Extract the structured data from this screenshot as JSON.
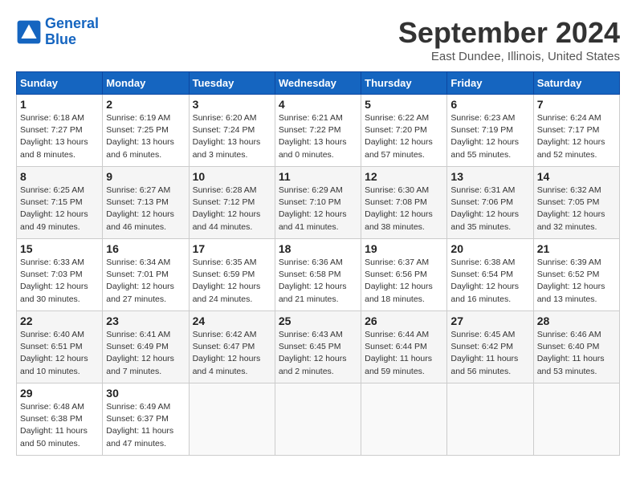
{
  "logo": {
    "line1": "General",
    "line2": "Blue"
  },
  "title": "September 2024",
  "subtitle": "East Dundee, Illinois, United States",
  "weekdays": [
    "Sunday",
    "Monday",
    "Tuesday",
    "Wednesday",
    "Thursday",
    "Friday",
    "Saturday"
  ],
  "weeks": [
    [
      {
        "day": "1",
        "sunrise": "Sunrise: 6:18 AM",
        "sunset": "Sunset: 7:27 PM",
        "daylight": "Daylight: 13 hours and 8 minutes."
      },
      {
        "day": "2",
        "sunrise": "Sunrise: 6:19 AM",
        "sunset": "Sunset: 7:25 PM",
        "daylight": "Daylight: 13 hours and 6 minutes."
      },
      {
        "day": "3",
        "sunrise": "Sunrise: 6:20 AM",
        "sunset": "Sunset: 7:24 PM",
        "daylight": "Daylight: 13 hours and 3 minutes."
      },
      {
        "day": "4",
        "sunrise": "Sunrise: 6:21 AM",
        "sunset": "Sunset: 7:22 PM",
        "daylight": "Daylight: 13 hours and 0 minutes."
      },
      {
        "day": "5",
        "sunrise": "Sunrise: 6:22 AM",
        "sunset": "Sunset: 7:20 PM",
        "daylight": "Daylight: 12 hours and 57 minutes."
      },
      {
        "day": "6",
        "sunrise": "Sunrise: 6:23 AM",
        "sunset": "Sunset: 7:19 PM",
        "daylight": "Daylight: 12 hours and 55 minutes."
      },
      {
        "day": "7",
        "sunrise": "Sunrise: 6:24 AM",
        "sunset": "Sunset: 7:17 PM",
        "daylight": "Daylight: 12 hours and 52 minutes."
      }
    ],
    [
      {
        "day": "8",
        "sunrise": "Sunrise: 6:25 AM",
        "sunset": "Sunset: 7:15 PM",
        "daylight": "Daylight: 12 hours and 49 minutes."
      },
      {
        "day": "9",
        "sunrise": "Sunrise: 6:27 AM",
        "sunset": "Sunset: 7:13 PM",
        "daylight": "Daylight: 12 hours and 46 minutes."
      },
      {
        "day": "10",
        "sunrise": "Sunrise: 6:28 AM",
        "sunset": "Sunset: 7:12 PM",
        "daylight": "Daylight: 12 hours and 44 minutes."
      },
      {
        "day": "11",
        "sunrise": "Sunrise: 6:29 AM",
        "sunset": "Sunset: 7:10 PM",
        "daylight": "Daylight: 12 hours and 41 minutes."
      },
      {
        "day": "12",
        "sunrise": "Sunrise: 6:30 AM",
        "sunset": "Sunset: 7:08 PM",
        "daylight": "Daylight: 12 hours and 38 minutes."
      },
      {
        "day": "13",
        "sunrise": "Sunrise: 6:31 AM",
        "sunset": "Sunset: 7:06 PM",
        "daylight": "Daylight: 12 hours and 35 minutes."
      },
      {
        "day": "14",
        "sunrise": "Sunrise: 6:32 AM",
        "sunset": "Sunset: 7:05 PM",
        "daylight": "Daylight: 12 hours and 32 minutes."
      }
    ],
    [
      {
        "day": "15",
        "sunrise": "Sunrise: 6:33 AM",
        "sunset": "Sunset: 7:03 PM",
        "daylight": "Daylight: 12 hours and 30 minutes."
      },
      {
        "day": "16",
        "sunrise": "Sunrise: 6:34 AM",
        "sunset": "Sunset: 7:01 PM",
        "daylight": "Daylight: 12 hours and 27 minutes."
      },
      {
        "day": "17",
        "sunrise": "Sunrise: 6:35 AM",
        "sunset": "Sunset: 6:59 PM",
        "daylight": "Daylight: 12 hours and 24 minutes."
      },
      {
        "day": "18",
        "sunrise": "Sunrise: 6:36 AM",
        "sunset": "Sunset: 6:58 PM",
        "daylight": "Daylight: 12 hours and 21 minutes."
      },
      {
        "day": "19",
        "sunrise": "Sunrise: 6:37 AM",
        "sunset": "Sunset: 6:56 PM",
        "daylight": "Daylight: 12 hours and 18 minutes."
      },
      {
        "day": "20",
        "sunrise": "Sunrise: 6:38 AM",
        "sunset": "Sunset: 6:54 PM",
        "daylight": "Daylight: 12 hours and 16 minutes."
      },
      {
        "day": "21",
        "sunrise": "Sunrise: 6:39 AM",
        "sunset": "Sunset: 6:52 PM",
        "daylight": "Daylight: 12 hours and 13 minutes."
      }
    ],
    [
      {
        "day": "22",
        "sunrise": "Sunrise: 6:40 AM",
        "sunset": "Sunset: 6:51 PM",
        "daylight": "Daylight: 12 hours and 10 minutes."
      },
      {
        "day": "23",
        "sunrise": "Sunrise: 6:41 AM",
        "sunset": "Sunset: 6:49 PM",
        "daylight": "Daylight: 12 hours and 7 minutes."
      },
      {
        "day": "24",
        "sunrise": "Sunrise: 6:42 AM",
        "sunset": "Sunset: 6:47 PM",
        "daylight": "Daylight: 12 hours and 4 minutes."
      },
      {
        "day": "25",
        "sunrise": "Sunrise: 6:43 AM",
        "sunset": "Sunset: 6:45 PM",
        "daylight": "Daylight: 12 hours and 2 minutes."
      },
      {
        "day": "26",
        "sunrise": "Sunrise: 6:44 AM",
        "sunset": "Sunset: 6:44 PM",
        "daylight": "Daylight: 11 hours and 59 minutes."
      },
      {
        "day": "27",
        "sunrise": "Sunrise: 6:45 AM",
        "sunset": "Sunset: 6:42 PM",
        "daylight": "Daylight: 11 hours and 56 minutes."
      },
      {
        "day": "28",
        "sunrise": "Sunrise: 6:46 AM",
        "sunset": "Sunset: 6:40 PM",
        "daylight": "Daylight: 11 hours and 53 minutes."
      }
    ],
    [
      {
        "day": "29",
        "sunrise": "Sunrise: 6:48 AM",
        "sunset": "Sunset: 6:38 PM",
        "daylight": "Daylight: 11 hours and 50 minutes."
      },
      {
        "day": "30",
        "sunrise": "Sunrise: 6:49 AM",
        "sunset": "Sunset: 6:37 PM",
        "daylight": "Daylight: 11 hours and 47 minutes."
      },
      null,
      null,
      null,
      null,
      null
    ]
  ]
}
